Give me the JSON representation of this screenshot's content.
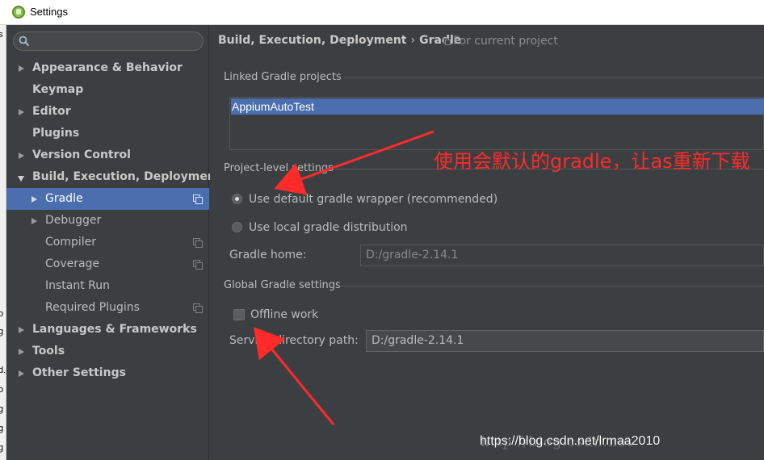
{
  "window": {
    "title": "Settings"
  },
  "left_strip": {
    "chars": [
      "s",
      "o",
      "g",
      "d.",
      "o",
      "g",
      "g",
      "g"
    ]
  },
  "search": {
    "value": "",
    "placeholder": ""
  },
  "sidebar": {
    "items": [
      {
        "label": "Appearance & Behavior"
      },
      {
        "label": "Keymap"
      },
      {
        "label": "Editor"
      },
      {
        "label": "Plugins"
      },
      {
        "label": "Version Control"
      },
      {
        "label": "Build, Execution, Deployment"
      },
      {
        "label": "Gradle"
      },
      {
        "label": "Debugger"
      },
      {
        "label": "Compiler"
      },
      {
        "label": "Coverage"
      },
      {
        "label": "Instant Run"
      },
      {
        "label": "Required Plugins"
      },
      {
        "label": "Languages & Frameworks"
      },
      {
        "label": "Tools"
      },
      {
        "label": "Other Settings"
      }
    ]
  },
  "header": {
    "breadcrumb_parent": "Build, Execution, Deployment",
    "breadcrumb_separator": "›",
    "breadcrumb_current": "Gradle",
    "scope_text": "For current project"
  },
  "linked_projects": {
    "title": "Linked Gradle projects",
    "items": [
      "AppiumAutoTest"
    ]
  },
  "project_settings": {
    "title": "Project-level settings",
    "option_default_wrapper": "Use default gradle wrapper (recommended)",
    "option_local_distribution": "Use local gradle distribution",
    "gradle_home_label": "Gradle home:",
    "gradle_home_value": "D:/gradle-2.14.1"
  },
  "global_settings": {
    "title": "Global Gradle settings",
    "offline_work_label": "Offline work",
    "service_directory_label": "Service directory path:",
    "service_directory_value": "D:/gradle-2.14.1"
  },
  "annotation": {
    "text": "使用会默认的gradle，让as重新下载"
  },
  "watermark": {
    "text": "https://blog.csdn.net/lrmaa2010",
    "ghost": "http://blog.csdn.net"
  },
  "colors": {
    "background": "#3c3f41",
    "selection": "#4b6eaf",
    "annotation": "#ff2a2a"
  }
}
